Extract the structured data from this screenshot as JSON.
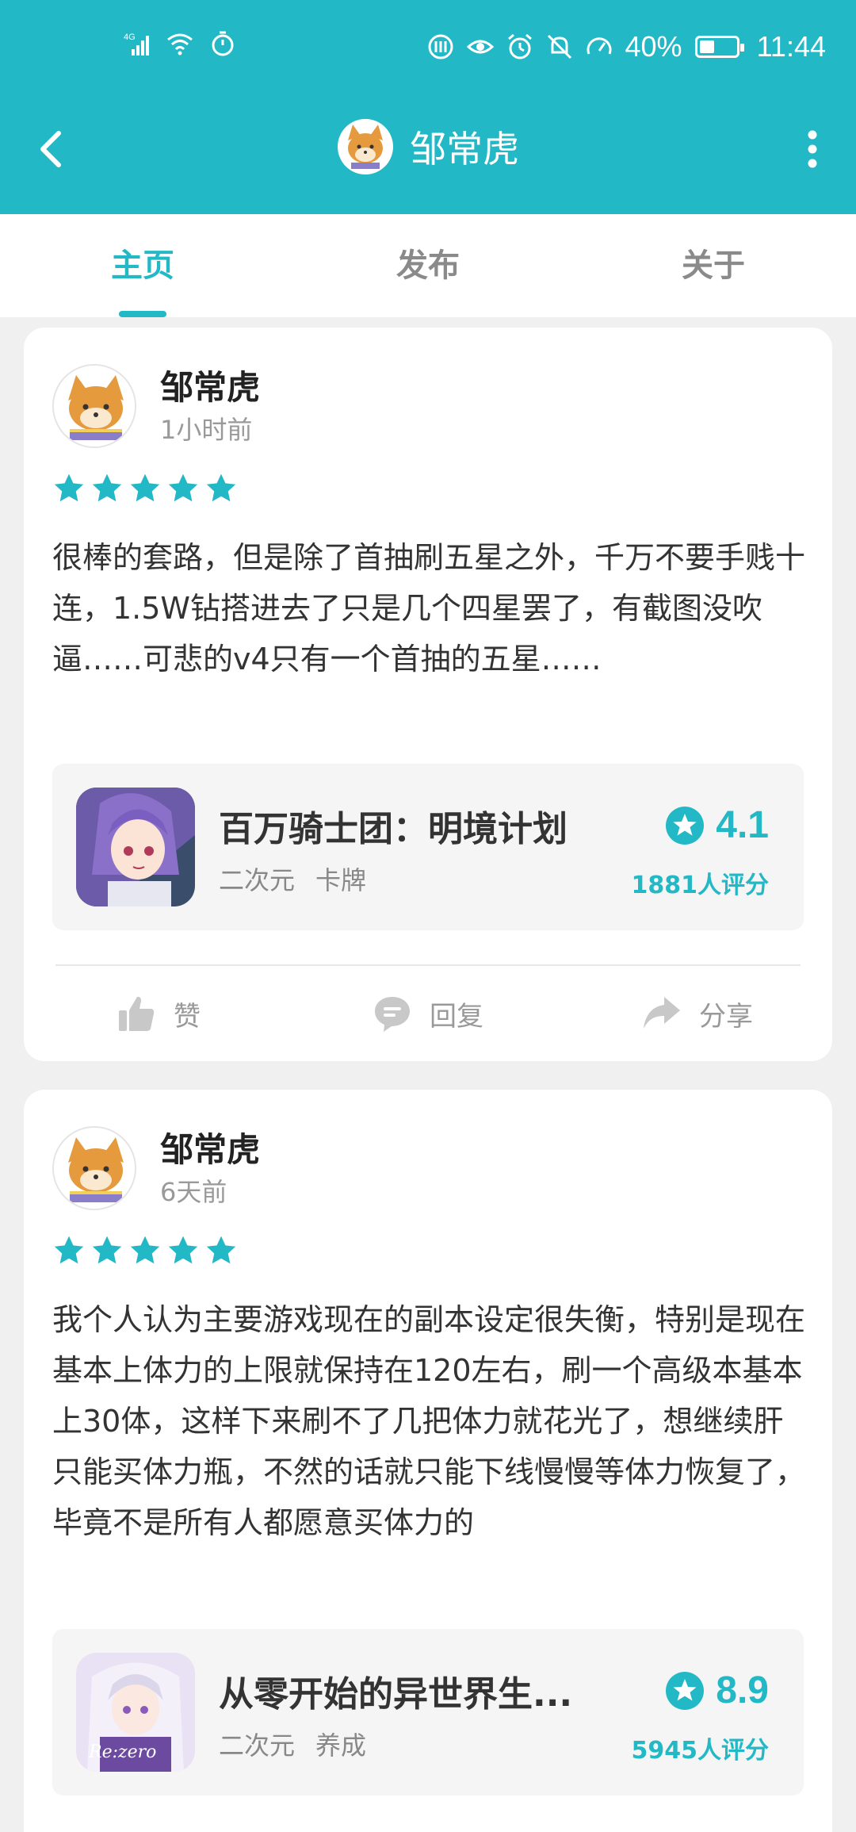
{
  "status_bar": {
    "network": "4G",
    "battery": "40%",
    "time": "11:44"
  },
  "header": {
    "title": "邹常虎"
  },
  "tabs": [
    {
      "label": "主页",
      "active": true
    },
    {
      "label": "发布",
      "active": false
    },
    {
      "label": "关于",
      "active": false
    }
  ],
  "posts": [
    {
      "username": "邹常虎",
      "time": "1小时前",
      "stars": 5,
      "text": "很棒的套路，但是除了首抽刷五星之外，千万不要手贱十连，1.5W钻搭进去了只是几个四星罢了，有截图没吹逼……可悲的v4只有一个首抽的五星……",
      "game": {
        "name": "百万骑士团：明境计划",
        "tags": [
          "二次元",
          "卡牌"
        ],
        "score": "4.1",
        "rating_count": "1881人评分"
      },
      "actions": {
        "like": "赞",
        "reply": "回复",
        "share": "分享"
      }
    },
    {
      "username": "邹常虎",
      "time": "6天前",
      "stars": 5,
      "text": "我个人认为主要游戏现在的副本设定很失衡，特别是现在基本上体力的上限就保持在120左右，刷一个高级本基本上30体，这样下来刷不了几把体力就花光了，想继续肝只能买体力瓶，不然的话就只能下线慢慢等体力恢复了，毕竟不是所有人都愿意买体力的",
      "game": {
        "name": "从零开始的异世界生...",
        "tags": [
          "二次元",
          "养成"
        ],
        "score": "8.9",
        "rating_count": "5945人评分"
      }
    }
  ],
  "colors": {
    "accent": "#22b8c6",
    "background": "#f0f0f0",
    "card": "#ffffff"
  }
}
